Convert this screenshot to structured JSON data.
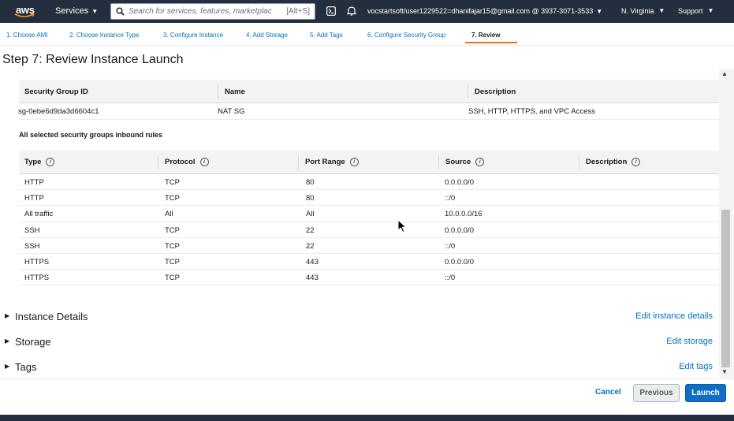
{
  "nav": {
    "logo_text": "aws",
    "services_label": "Services",
    "search_placeholder": "Search for services, features, marketplac",
    "search_shortcut": "[Alt+S]",
    "account": "vocstartsoft/user1229522=dhanifajar15@gmail.com @ 3937-3071-3533",
    "region": "N. Virginia",
    "support": "Support"
  },
  "steps": [
    {
      "label": "1. Choose AMI"
    },
    {
      "label": "2. Choose Instance Type"
    },
    {
      "label": "3. Configure Instance"
    },
    {
      "label": "4. Add Storage"
    },
    {
      "label": "5. Add Tags"
    },
    {
      "label": "6. Configure Security Group"
    },
    {
      "label": "7. Review"
    }
  ],
  "page_title": "Step 7: Review Instance Launch",
  "security_groups": {
    "headers": [
      "Security Group ID",
      "Name",
      "Description"
    ],
    "rows": [
      [
        "sg-0ebe6d9da3d6604c1",
        "NAT SG",
        "SSH, HTTP, HTTPS, and VPC Access"
      ]
    ]
  },
  "inbound_label": "All selected security groups inbound rules",
  "inbound_rules": {
    "headers": [
      "Type",
      "Protocol",
      "Port Range",
      "Source",
      "Description"
    ],
    "rows": [
      [
        "HTTP",
        "TCP",
        "80",
        "0.0.0.0/0",
        ""
      ],
      [
        "HTTP",
        "TCP",
        "80",
        "::/0",
        ""
      ],
      [
        "All traffic",
        "All",
        "All",
        "10.0.0.0/16",
        ""
      ],
      [
        "SSH",
        "TCP",
        "22",
        "0.0.0.0/0",
        ""
      ],
      [
        "SSH",
        "TCP",
        "22",
        "::/0",
        ""
      ],
      [
        "HTTPS",
        "TCP",
        "443",
        "0.0.0.0/0",
        ""
      ],
      [
        "HTTPS",
        "TCP",
        "443",
        "::/0",
        ""
      ]
    ]
  },
  "sections": [
    {
      "title": "Instance Details",
      "edit": "Edit instance details"
    },
    {
      "title": "Storage",
      "edit": "Edit storage"
    },
    {
      "title": "Tags",
      "edit": "Edit tags"
    }
  ],
  "footer": {
    "cancel": "Cancel",
    "previous": "Previous",
    "launch": "Launch"
  },
  "colors": {
    "nav_bg": "#232f3e",
    "link": "#0073bb",
    "primary_button": "#0f6fc6",
    "active_step_underline": "#ec7211"
  }
}
